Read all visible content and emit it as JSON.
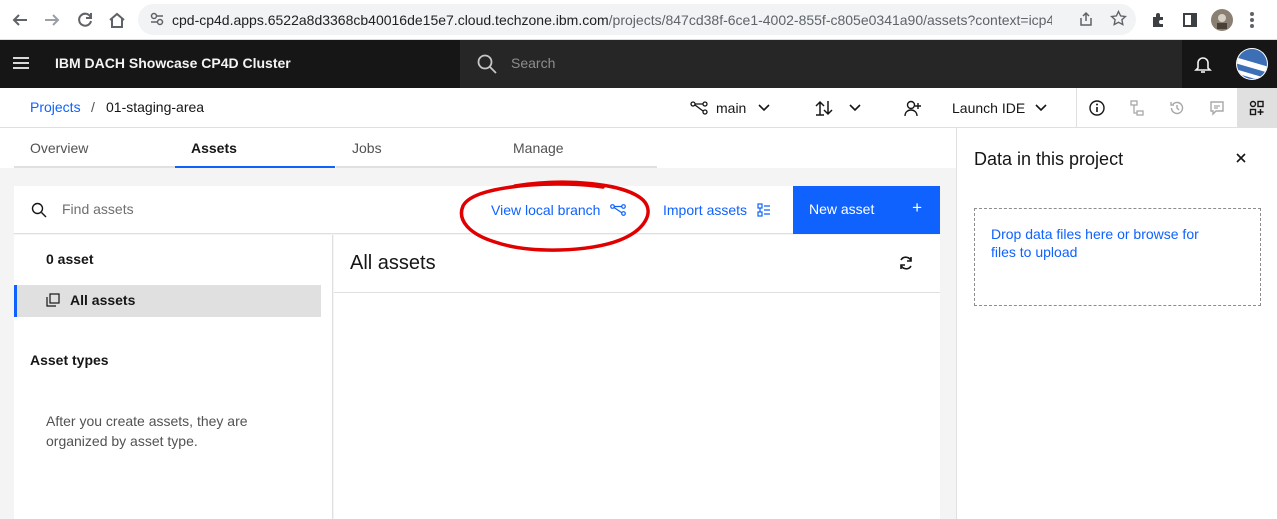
{
  "browser": {
    "url_host": "cpd-cp4d.apps.6522a8d3368cb40016de15e7.cloud.techzone.ibm.com",
    "url_path": "/projects/847cd38f-6ce1-4002-855f-c805e0341a90/assets?context=icp4d..."
  },
  "header": {
    "app_title": "IBM DACH Showcase CP4D Cluster",
    "search_placeholder": "Search"
  },
  "breadcrumb": {
    "projects": "Projects",
    "separator": "/",
    "current": "01-staging-area"
  },
  "toolbar": {
    "branch": "main",
    "launch_ide": "Launch IDE"
  },
  "tabs": [
    {
      "label": "Overview"
    },
    {
      "label": "Assets"
    },
    {
      "label": "Jobs"
    },
    {
      "label": "Manage"
    }
  ],
  "assets_toolbar": {
    "find_placeholder": "Find assets",
    "view_local_branch": "View local branch",
    "import_assets": "Import assets",
    "new_asset": "New asset",
    "plus": "+"
  },
  "left_panel": {
    "asset_count": "0 asset",
    "all_assets": "All assets",
    "asset_types": "Asset types",
    "empty_note": "After you create assets, they are organized by asset type."
  },
  "main_pane": {
    "title": "All assets"
  },
  "side_panel": {
    "title": "Data in this project",
    "close": "×",
    "dropzone_text": "Drop data files here or browse for files to upload"
  },
  "colors": {
    "ibm_blue": "#0f62fe",
    "header_bg": "#161616",
    "annotation_red": "#e00000"
  }
}
